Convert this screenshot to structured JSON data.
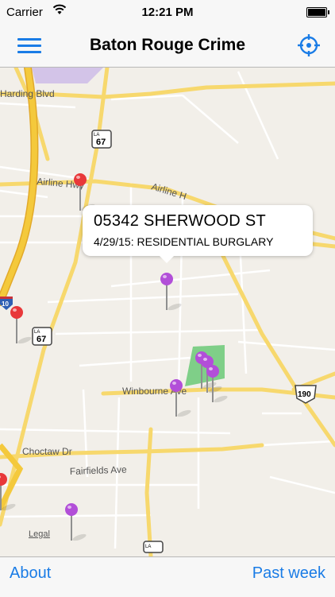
{
  "status_bar": {
    "carrier": "Carrier",
    "time": "12:21 PM"
  },
  "nav": {
    "title": "Baton Rouge Crime",
    "menu_icon": "hamburger-menu-icon",
    "locate_icon": "locate-crosshair-icon"
  },
  "map": {
    "road_labels": {
      "harding": "Harding Blvd",
      "airline_1": "Airline Hwy",
      "airline_2": "Airline H",
      "winbourne": "Winbourne Ave",
      "choctaw": "Choctaw Dr",
      "fairfields": "Fairfields Ave"
    },
    "shields": {
      "la67_top": "67",
      "la67_mid": "67",
      "us190": "190",
      "i10": "10",
      "state": "LA"
    },
    "legal": "Legal",
    "colors": {
      "crime_pin": "#b24fd8",
      "selected_pin": "#e8383a",
      "land": "#f2efe9",
      "park": "#7fcf88",
      "highway": "#f4c93c"
    }
  },
  "callout": {
    "title": "05342  SHERWOOD ST",
    "subtitle": "4/29/15: RESIDENTIAL BURGLARY"
  },
  "toolbar": {
    "about": "About",
    "range": "Past week"
  }
}
